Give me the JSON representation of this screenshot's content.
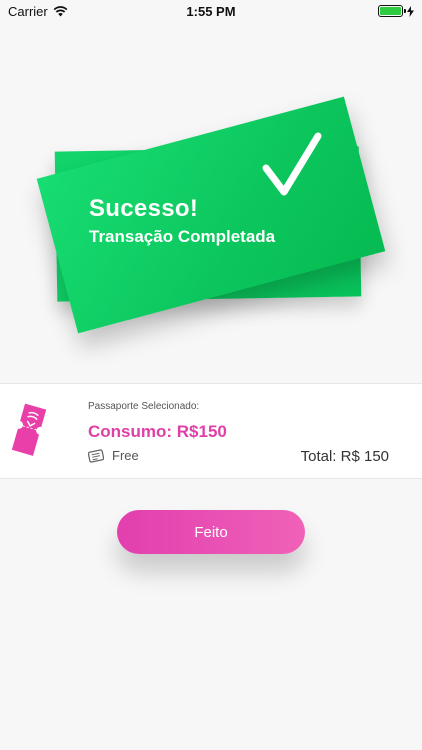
{
  "status_bar": {
    "carrier": "Carrier",
    "time": "1:55 PM",
    "battery_level": 1.0,
    "icons": [
      "wifi-icon",
      "battery-icon",
      "charging-bolt-icon"
    ]
  },
  "success_card": {
    "title": "Sucesso!",
    "subtitle": "Transação Completada",
    "icon": "checkmark-icon",
    "color": "#0ecb61"
  },
  "passport": {
    "label": "Passaporte Selecionado:",
    "name": "Consumo: R$150",
    "type": "Free",
    "total": "Total: R$ 150",
    "icon": "ticket-icon",
    "type_icon": "pass-card-icon",
    "accent_color": "#e040a6"
  },
  "done_button": {
    "label": "Feito",
    "color": "#e44bb0"
  }
}
